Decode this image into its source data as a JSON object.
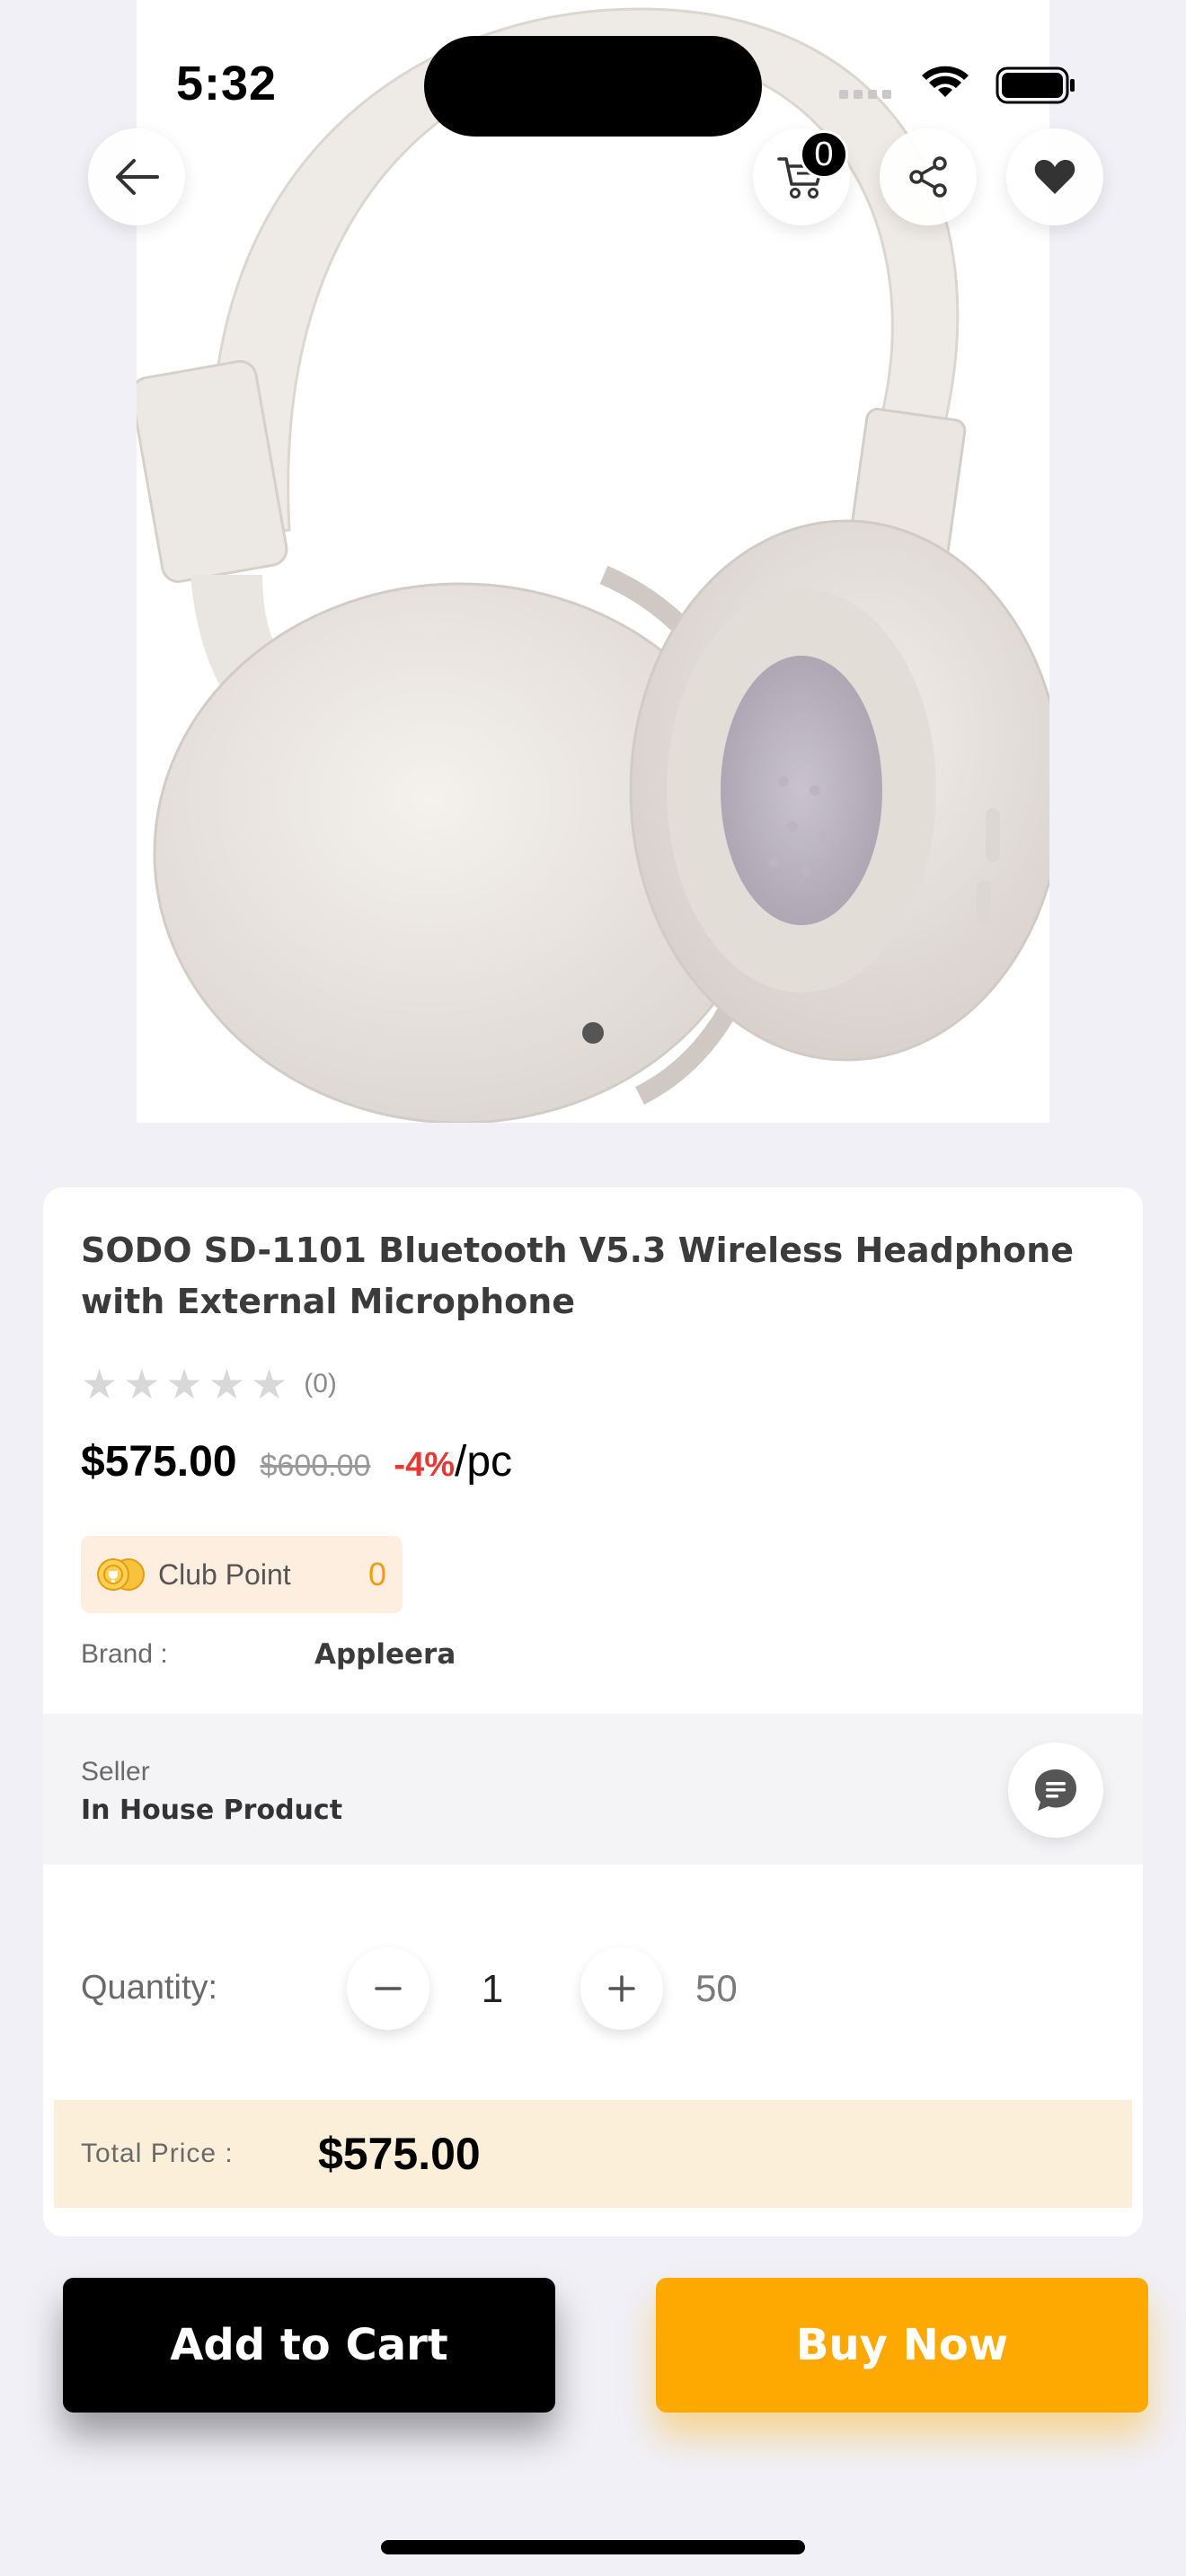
{
  "status_bar": {
    "time": "5:32"
  },
  "top_bar": {
    "cart_count": "0"
  },
  "product": {
    "title": "SODO SD-1101 Bluetooth V5.3 Wireless Headphone with External Microphone",
    "rating": {
      "stars": 0,
      "max_stars": 5,
      "count_label": "(0)"
    },
    "price": "$575.00",
    "old_price": "$600.00",
    "discount": "-4%",
    "unit": "/pc",
    "club_point": {
      "label": "Club Point",
      "value": "0"
    },
    "brand": {
      "label": "Brand :",
      "value": "Appleera"
    }
  },
  "seller": {
    "label": "Seller",
    "name": "In House Product"
  },
  "quantity": {
    "label": "Quantity:",
    "value": "1",
    "stock": "50"
  },
  "total": {
    "label": "Total Price :",
    "value": "$575.00"
  },
  "actions": {
    "add_to_cart": "Add to Cart",
    "buy_now": "Buy Now"
  },
  "colors": {
    "accent": "#fea902",
    "discount": "#e53935",
    "total_bg": "#fcefd9",
    "club_bg": "#fdeee0"
  }
}
